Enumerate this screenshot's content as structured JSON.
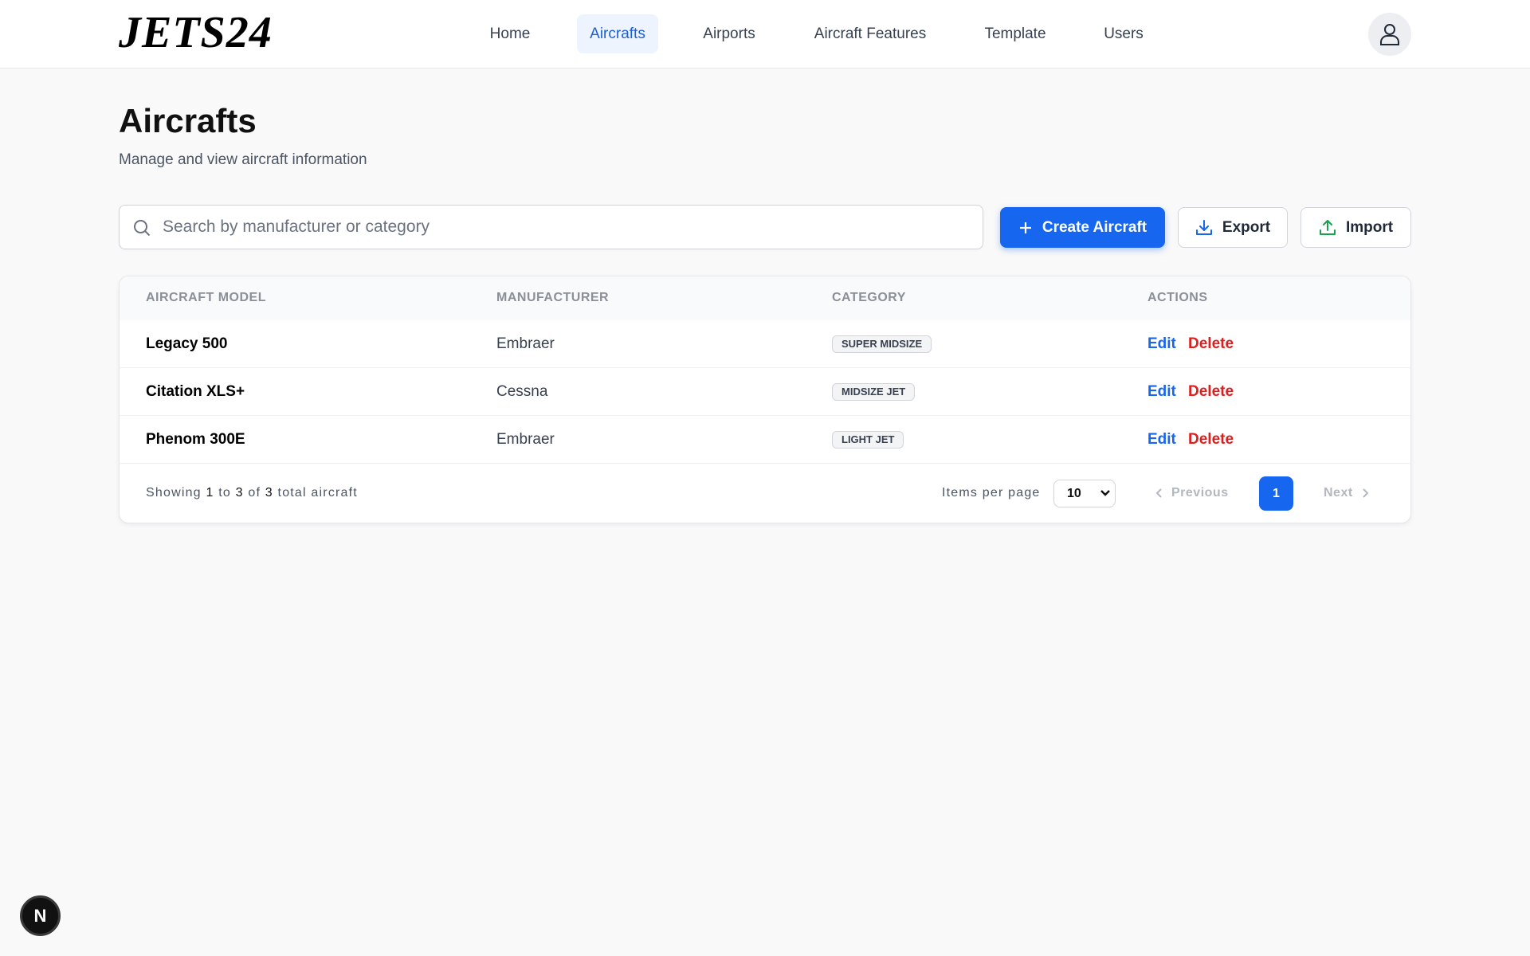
{
  "brand": {
    "logo_text": "JETS24"
  },
  "nav": {
    "items": [
      {
        "label": "Home",
        "active": false
      },
      {
        "label": "Aircrafts",
        "active": true
      },
      {
        "label": "Airports",
        "active": false
      },
      {
        "label": "Aircraft Features",
        "active": false
      },
      {
        "label": "Template",
        "active": false
      },
      {
        "label": "Users",
        "active": false
      }
    ],
    "avatar_icon": "user-icon"
  },
  "page": {
    "title": "Aircrafts",
    "subtitle": "Manage and view aircraft information"
  },
  "toolbar": {
    "search_placeholder": "Search by manufacturer or category",
    "search_value": "",
    "create_label": "Create Aircraft",
    "export_label": "Export",
    "import_label": "Import"
  },
  "table": {
    "columns": [
      "AIRCRAFT MODEL",
      "MANUFACTURER",
      "CATEGORY",
      "ACTIONS"
    ],
    "rows": [
      {
        "model": "Legacy 500",
        "manufacturer": "Embraer",
        "category": "SUPER MIDSIZE",
        "edit": "Edit",
        "delete": "Delete"
      },
      {
        "model": "Citation XLS+",
        "manufacturer": "Cessna",
        "category": "MIDSIZE JET",
        "edit": "Edit",
        "delete": "Delete"
      },
      {
        "model": "Phenom 300E",
        "manufacturer": "Embraer",
        "category": "LIGHT JET",
        "edit": "Edit",
        "delete": "Delete"
      }
    ]
  },
  "footer": {
    "showing_prefix": "Showing",
    "from": "1",
    "to_word": "to",
    "to": "3",
    "of_word": "of",
    "total": "3",
    "suffix": "total aircraft",
    "items_per_page_label": "Items per page",
    "items_per_page_value": "10",
    "previous_label": "Previous",
    "current_page": "1",
    "next_label": "Next"
  },
  "dev_badge": {
    "letter": "N"
  },
  "colors": {
    "accent": "#1766f0",
    "danger": "#dc1f1f",
    "active_nav_bg": "#eef4fd",
    "page_bg": "#f9f9f9"
  }
}
